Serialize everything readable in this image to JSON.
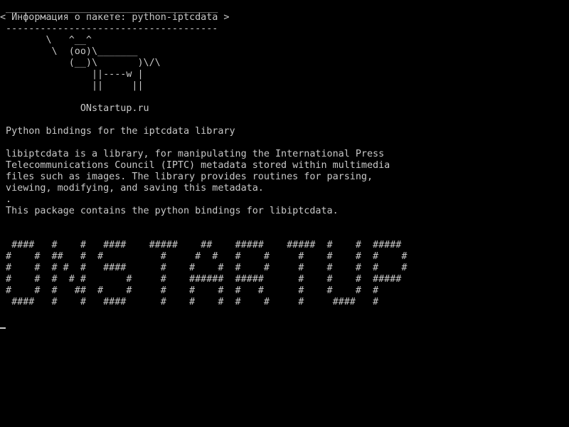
{
  "colors": {
    "background": "#000000",
    "foreground": "#c8c8c8"
  },
  "bubble": {
    "top_border": " _____________________________________",
    "text": "< Информация о пакете: python-iptcdata >",
    "bottom_border": " -------------------------------------"
  },
  "cow": [
    "        \\   ^__^",
    "         \\  (oo)\\_______",
    "            (__)\\       )\\/\\",
    "                ||----w |",
    "                ||     ||"
  ],
  "site": "              ONstartup.ru",
  "summary": " Python bindings for the iptcdata library",
  "description": [
    " libiptcdata is a library, for manipulating the International Press",
    " Telecommunications Council (IPTC) metadata stored within multimedia",
    " files such as images. The library provides routines for parsing,",
    " viewing, modifying, and saving this metadata.",
    " .",
    " This package contains the python bindings for libiptcdata."
  ],
  "banner": [
    "  ####   #    #   ####    #####    ##    #####    #####  #    #  #####",
    " #    #  ##   #  #          #     #  #   #    #     #    #    #  #    #",
    " #    #  # #  #   ####      #    #    #  #    #     #    #    #  #    #",
    " #    #  #  # #       #     #    ######  #####      #    #    #  #####",
    " #    #  #   ##  #    #     #    #    #  #   #      #    #    #  #",
    "  ####   #    #   ####      #    #    #  #    #     #     ####   #"
  ],
  "prompt": ""
}
